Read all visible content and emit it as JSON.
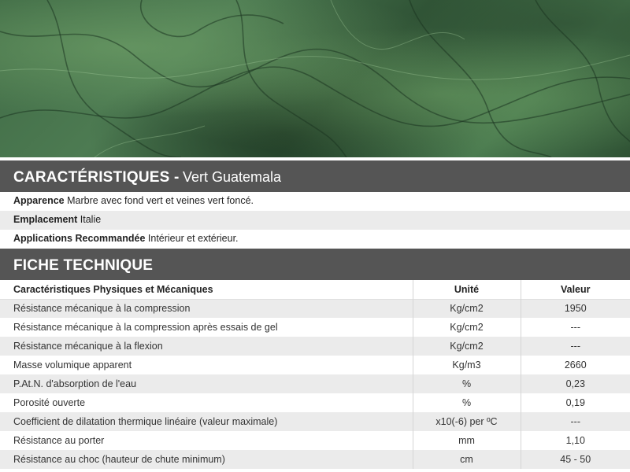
{
  "hero": {
    "image": "green-marble-texture"
  },
  "characteristics": {
    "title": "CARACTÉRISTIQUES -",
    "subtitle": "Vert Guatemala",
    "rows": [
      {
        "label": "Apparence",
        "value": "Marbre avec fond vert et veines vert foncé."
      },
      {
        "label": "Emplacement",
        "value": "Italie"
      },
      {
        "label": "Applications Recommandée",
        "value": "Intérieur et extérieur."
      }
    ]
  },
  "technical": {
    "title": "FICHE TECHNIQUE",
    "headers": [
      "Caractéristiques Physiques et Mécaniques",
      "Unité",
      "Valeur"
    ],
    "rows": [
      [
        "Résistance mécanique à la compression",
        "Kg/cm2",
        "1950"
      ],
      [
        "Résistance mécanique à la compression après essais de gel",
        "Kg/cm2",
        "---"
      ],
      [
        "Résistance mécanique à la flexion",
        "Kg/cm2",
        "---"
      ],
      [
        "Masse volumique apparent",
        "Kg/m3",
        "2660"
      ],
      [
        "P.At.N. d'absorption de l'eau",
        "%",
        "0,23"
      ],
      [
        "Porosité ouverte",
        "%",
        "0,19"
      ],
      [
        "Coefficient de dilatation thermique linéaire (valeur maximale)",
        "x10(-6) per ºC",
        "---"
      ],
      [
        "Résistance au porter",
        "mm",
        "1,10"
      ],
      [
        "Résistance au choc (hauteur de chute minimum)",
        "cm",
        "45 - 50"
      ]
    ]
  },
  "colors": {
    "header_bar": "#555555",
    "stripe": "#ebebeb",
    "marble": "#3f6a45"
  }
}
